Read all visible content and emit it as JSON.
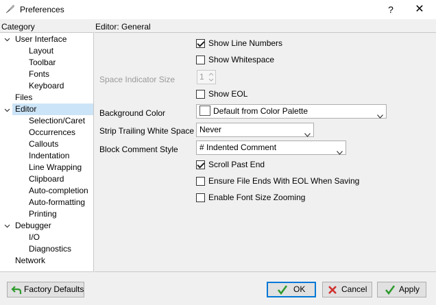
{
  "window": {
    "title": "Preferences",
    "help_glyph": "?",
    "close_glyph": "✕"
  },
  "category_header": "Category",
  "editor_header": "Editor: General",
  "tree": [
    {
      "label": "User Interface",
      "level": 0,
      "expandable": true
    },
    {
      "label": "Layout",
      "level": 1
    },
    {
      "label": "Toolbar",
      "level": 1
    },
    {
      "label": "Fonts",
      "level": 1
    },
    {
      "label": "Keyboard",
      "level": 1
    },
    {
      "label": "Files",
      "level": 0
    },
    {
      "label": "Editor",
      "level": 0,
      "expandable": true,
      "selected": true
    },
    {
      "label": "Selection/Caret",
      "level": 1
    },
    {
      "label": "Occurrences",
      "level": 1
    },
    {
      "label": "Callouts",
      "level": 1
    },
    {
      "label": "Indentation",
      "level": 1
    },
    {
      "label": "Line Wrapping",
      "level": 1
    },
    {
      "label": "Clipboard",
      "level": 1
    },
    {
      "label": "Auto-completion",
      "level": 1
    },
    {
      "label": "Auto-formatting",
      "level": 1
    },
    {
      "label": "Printing",
      "level": 1
    },
    {
      "label": "Debugger",
      "level": 0,
      "expandable": true
    },
    {
      "label": "I/O",
      "level": 1
    },
    {
      "label": "Diagnostics",
      "level": 1
    },
    {
      "label": "Network",
      "level": 0
    }
  ],
  "settings": {
    "show_line_numbers": {
      "label": "Show Line Numbers",
      "checked": true
    },
    "show_whitespace": {
      "label": "Show Whitespace",
      "checked": false
    },
    "space_indicator_size": {
      "label": "Space Indicator Size",
      "value": "1"
    },
    "show_eol": {
      "label": "Show EOL",
      "checked": false
    },
    "background_color": {
      "label": "Background Color",
      "value": "Default from Color Palette"
    },
    "strip_trailing": {
      "label": "Strip Trailing White Space",
      "value": "Never"
    },
    "block_comment": {
      "label": "Block Comment Style",
      "value": "# Indented Comment"
    },
    "scroll_past_end": {
      "label": "Scroll Past End",
      "checked": true
    },
    "ensure_eol": {
      "label": "Ensure File Ends With EOL When Saving",
      "checked": false
    },
    "font_zoom": {
      "label": "Enable Font Size Zooming",
      "checked": false
    }
  },
  "buttons": {
    "factory_defaults": "Factory Defaults",
    "ok": "OK",
    "cancel": "Cancel",
    "apply": "Apply"
  },
  "colors": {
    "selection": "#cce4f7",
    "ok_check": "#2e9a2e",
    "cancel_x": "#d0312d",
    "factory_arrow": "#2e9a2e"
  }
}
